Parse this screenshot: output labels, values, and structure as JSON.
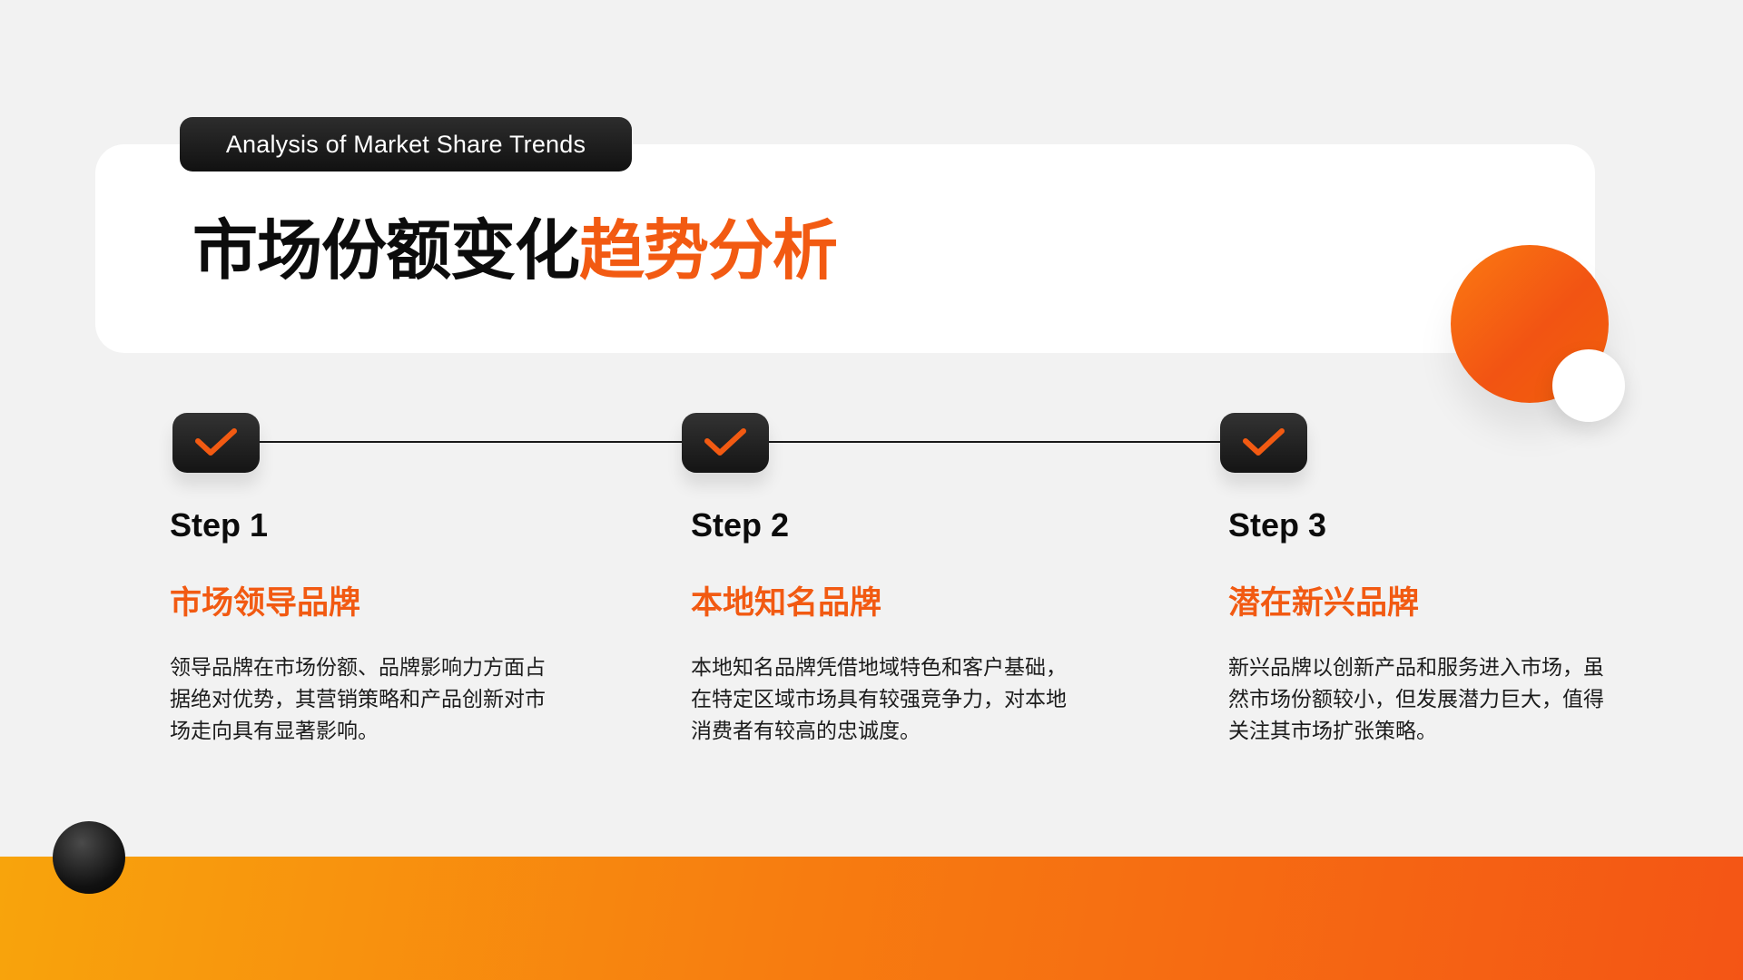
{
  "header": {
    "subtitle": "Analysis of Market Share Trends",
    "title_dark": "市场份额变化",
    "title_accent": "趋势分析"
  },
  "steps": [
    {
      "label": "Step 1",
      "heading": "市场领导品牌",
      "description": "领导品牌在市场份额、品牌影响力方面占据绝对优势，其营销策略和产品创新对市场走向具有显著影响。",
      "icon": "check-icon"
    },
    {
      "label": "Step 2",
      "heading": "本地知名品牌",
      "description": "本地知名品牌凭借地域特色和客户基础，在特定区域市场具有较强竞争力，对本地消费者有较高的忠诚度。",
      "icon": "check-icon"
    },
    {
      "label": "Step 3",
      "heading": "潜在新兴品牌",
      "description": "新兴品牌以创新产品和服务进入市场，虽然市场份额较小，但发展潜力巨大，值得关注其市场扩张策略。",
      "icon": "check-icon"
    }
  ],
  "colors": {
    "accent": "#f25a12",
    "dark": "#0c0c0c",
    "background": "#f2f2f2",
    "band_start": "#f8a40c",
    "band_end": "#f45515"
  }
}
